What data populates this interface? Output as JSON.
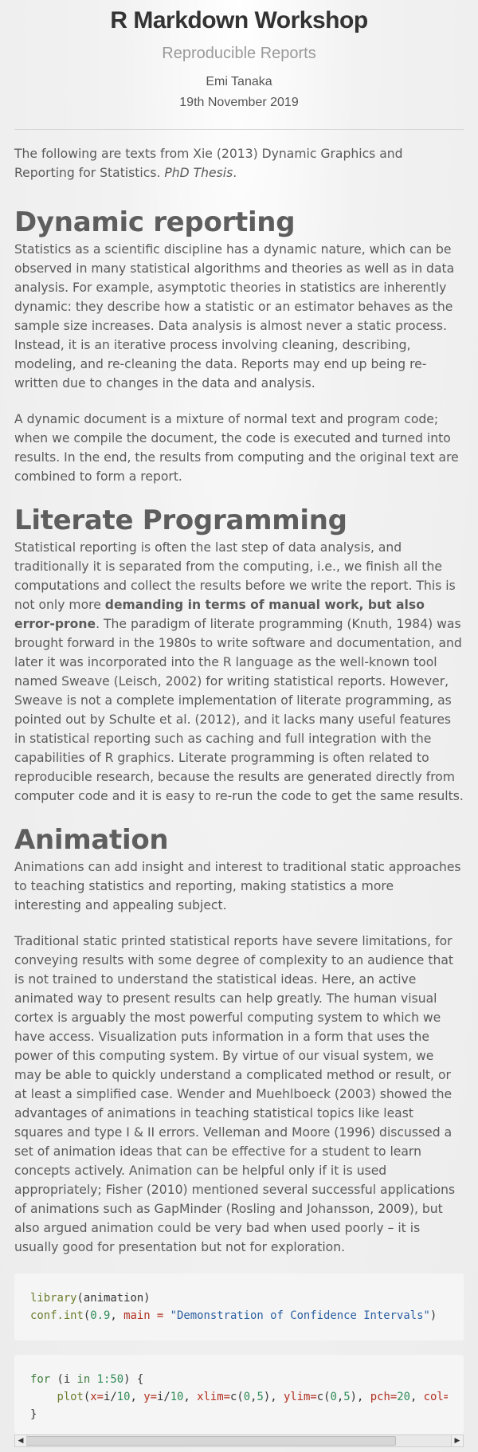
{
  "header": {
    "title": "R Markdown Workshop",
    "subtitle": "Reproducible Reports",
    "author": "Emi Tanaka",
    "date": "19th November 2019"
  },
  "intro": {
    "text": "The following are texts from Xie (2013) Dynamic Graphics and Reporting for Statistics. ",
    "emph": "PhD Thesis",
    "tail": "."
  },
  "sections": {
    "dynamic": {
      "heading": "Dynamic reporting",
      "p1": "Statistics as a scientific discipline has a dynamic nature, which can be observed in many statistical algorithms and theories as well as in data analysis. For example, asymptotic theories in statistics are inherently dynamic: they describe how a statistic or an estimator behaves as the sample size increases. Data analysis is almost never a static process. Instead, it is an iterative process involving cleaning, describing, modeling, and re-cleaning the data. Reports may end up being re-written due to changes in the data and analysis.",
      "p2": "A dynamic document is a mixture of normal text and program code; when we compile the document, the code is executed and turned into results. In the end, the results from computing and the original text are combined to form a report."
    },
    "literate": {
      "heading": "Literate Programming",
      "p1_before": "Statistical reporting is often the last step of data analysis, and traditionally it is separated from the computing, i.e., we finish all the computations and collect the results before we write the report. This is not only more ",
      "p1_bold": "demanding in terms of manual work, but also error-prone",
      "p1_after": ". The paradigm of literate programming (Knuth, 1984) was brought forward in the 1980s to write software and documentation, and later it was incorporated into the R language as the well-known tool named Sweave (Leisch, 2002) for writing statistical reports. However, Sweave is not a complete implementation of literate programming, as pointed out by Schulte et al. (2012), and it lacks many useful features in statistical reporting such as caching and full integration with the capabilities of R graphics. Literate programming is often related to reproducible research, because the results are generated directly from computer code and it is easy to re-run the code to get the same results."
    },
    "animation": {
      "heading": "Animation",
      "p1": "Animations can add insight and interest to traditional static approaches to teaching statistics and reporting, making statistics a more interesting and appealing subject.",
      "p2": "Traditional static printed statistical reports have severe limitations, for conveying results with some degree of complexity to an audience that is not trained to understand the statistical ideas. Here, an active animated way to present results can help greatly. The human visual cortex is arguably the most powerful computing system to which we have access. Visualization puts information in a form that uses the power of this computing system. By virtue of our visual system, we may be able to quickly understand a complicated method or result, or at least a simplified case. Wender and Muehlboeck (2003) showed the advantages of animations in teaching statistical topics like least squares and type I & II errors. Velleman and Moore (1996) discussed a set of animation ideas that can be effective for a student to learn concepts actively. Animation can be helpful only if it is used appropriately; Fisher (2010) mentioned several successful applications of animations such as GapMinder (Rosling and Johansson, 2009), but also argued animation could be very bad when used poorly – it is usually good for presentation but not for exploration."
    }
  },
  "code": {
    "block1": {
      "l1_fn": "library",
      "l1_rest": "(animation)",
      "l2_fn": "conf.int",
      "l2_open": "(",
      "l2_num": "0.9",
      "l2_sep": ", ",
      "l2_arg": "main =",
      "l2_sp": " ",
      "l2_str": "\"Demonstration of Confidence Intervals\"",
      "l2_close": ")"
    },
    "block2": {
      "l1_kw": "for",
      "l1_a": " (i ",
      "l1_in": "in",
      "l1_b": " ",
      "l1_n1": "1",
      "l1_colon": ":",
      "l1_n2": "50",
      "l1_c": ") {",
      "l2_indent": "    ",
      "l2_fn": "plot",
      "l2_open": "(",
      "l2_x": "x=",
      "l2_xv": "i/",
      "l2_xn": "10",
      "l2_s1": ", ",
      "l2_y": "y=",
      "l2_yv": "i/",
      "l2_yn": "10",
      "l2_s2": ", ",
      "l2_xlim": "xlim=",
      "l2_c1": "c(",
      "l2_x0": "0",
      "l2_cm1": ",",
      "l2_x5": "5",
      "l2_cl1": ")",
      "l2_s3": ", ",
      "l2_ylim": "ylim=",
      "l2_c2": "c(",
      "l2_y0": "0",
      "l2_cm2": ",",
      "l2_y5": "5",
      "l2_cl2": ")",
      "l2_s4": ", ",
      "l2_pch": "pch=",
      "l2_pchv": "20",
      "l2_s5": ", ",
      "l2_col": "col=",
      "l2_colv": "\"r",
      "l3": "}"
    }
  }
}
